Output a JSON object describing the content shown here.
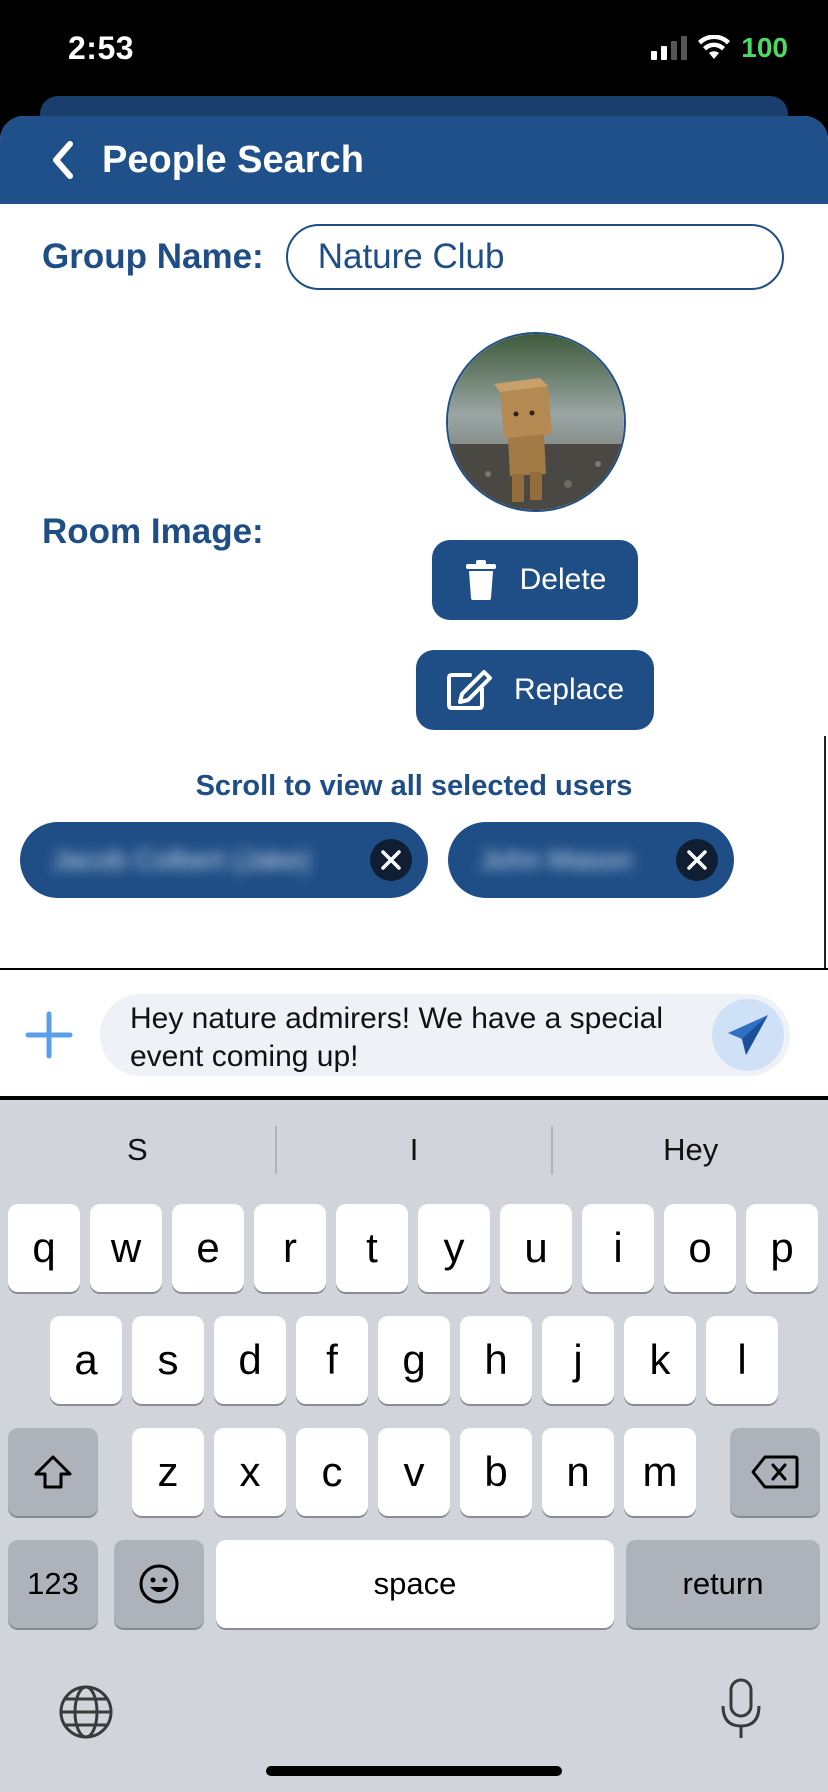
{
  "status": {
    "time": "2:53",
    "battery": "100"
  },
  "header": {
    "title": "People Search"
  },
  "form": {
    "group_label": "Group Name:",
    "group_value": "Nature Club",
    "room_label": "Room Image:",
    "delete_label": "Delete",
    "replace_label": "Replace",
    "scroll_hint": "Scroll to view all selected users",
    "chips": [
      "Jacob Colbert (Jake)",
      "John Mason"
    ]
  },
  "composer": {
    "message": "Hey nature admirers! We have a special event coming up!"
  },
  "keyboard": {
    "suggestions": [
      "S",
      "I",
      "Hey"
    ],
    "row1": [
      "q",
      "w",
      "e",
      "r",
      "t",
      "y",
      "u",
      "i",
      "o",
      "p"
    ],
    "row2": [
      "a",
      "s",
      "d",
      "f",
      "g",
      "h",
      "j",
      "k",
      "l"
    ],
    "row3": [
      "z",
      "x",
      "c",
      "v",
      "b",
      "n",
      "m"
    ],
    "numbers_label": "123",
    "space_label": "space",
    "return_label": "return"
  },
  "colors": {
    "primary": "#1f4e86",
    "header": "#1f5089",
    "battery": "#4cd964",
    "keyboard_bg": "#d1d4da"
  }
}
